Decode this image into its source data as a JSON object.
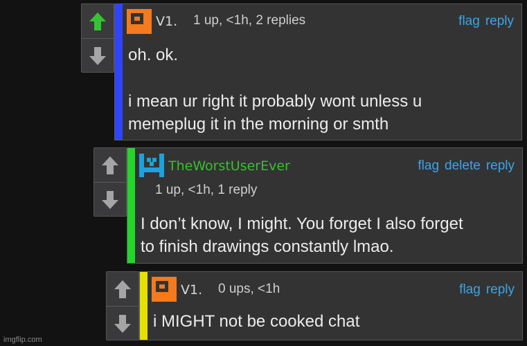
{
  "comments": [
    {
      "username": "V1.",
      "meta": "1 up, <1h, 2 replies",
      "actions": {
        "flag": "flag",
        "reply": "reply"
      },
      "paragraphs": [
        "oh. ok.",
        "i mean ur right it probably wont unless u\nmemeplug it in the morning or smth"
      ],
      "accent_color": "#2e44ff",
      "upvote_active": true,
      "avatar_icon": "orange-square-avatar"
    },
    {
      "username": "TheWorstUserEver",
      "meta": "1 up, <1h, 1 reply",
      "actions": {
        "flag": "flag",
        "delete": "delete",
        "reply": "reply"
      },
      "paragraphs": [
        "I don’t know, I might. You forget I also forget\nto finish drawings constantly lmao."
      ],
      "accent_color": "#22d62a",
      "upvote_active": false,
      "avatar_icon": "blue-pixel-avatar"
    },
    {
      "username": "V1.",
      "meta": "0 ups, <1h",
      "actions": {
        "flag": "flag",
        "reply": "reply"
      },
      "paragraphs": [
        "i MIGHT not be cooked chat"
      ],
      "accent_color": "#e6e000",
      "upvote_active": false,
      "avatar_icon": "orange-square-avatar"
    }
  ],
  "colors": {
    "link": "#39a6e8",
    "username_v1": "#d9d9d9",
    "username_worst": "#36c12c",
    "upvote_active": "#35c234",
    "arrow_inactive": "#a5a5a5"
  },
  "watermark": "imgflip.com"
}
